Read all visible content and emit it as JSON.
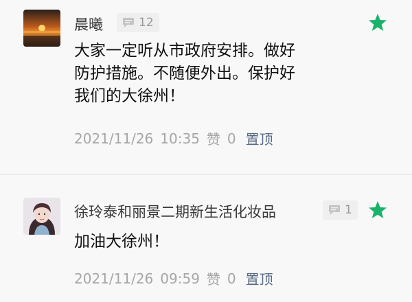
{
  "comments": [
    {
      "author": "晨曦",
      "reply_count": "12",
      "lines": [
        "大家一定听从市政府安排。做好",
        "防护措施。不随便外出。保护好",
        "我们的大徐州！"
      ],
      "date": "2021/11/26",
      "time": "10:35",
      "like_label": "赞",
      "like_count": "0",
      "pin_label": "置顶",
      "starred": true
    },
    {
      "author": "徐玲泰和丽景二期新生活化妆品",
      "reply_count": "1",
      "lines": [
        "加油大徐州！"
      ],
      "date": "2021/11/26",
      "time": "09:59",
      "like_label": "赞",
      "like_count": "0",
      "pin_label": "置顶",
      "starred": true
    }
  ],
  "colors": {
    "star": "#1ab36b",
    "pin": "#5a6b85",
    "meta": "#a6a6a6",
    "background": "#f8f8f8"
  },
  "icons": {
    "reply": "comment-bubble-icon",
    "star": "star-icon"
  }
}
